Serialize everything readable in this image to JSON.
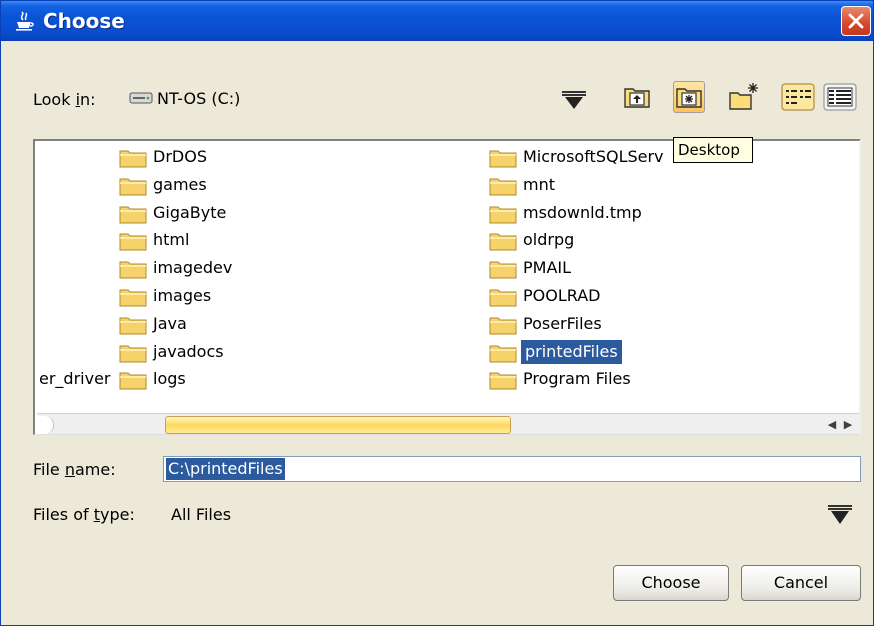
{
  "window": {
    "title": "Choose",
    "icon": "java-cup-icon",
    "close_icon": "close-icon"
  },
  "lookin": {
    "label": "Look in:",
    "mnemonic": "i",
    "value": "NT-OS (C:)",
    "icon": "drive-icon"
  },
  "toolbar": {
    "up_icon": "up-one-level-icon",
    "desktop_icon": "desktop-icon",
    "new_folder_icon": "new-folder-icon",
    "list_icon": "list-view-icon",
    "details_icon": "details-view-icon"
  },
  "tooltip": "Desktop",
  "files": {
    "cut_left_label": "er_driver",
    "col1": [
      "DrDOS",
      "games",
      "GigaByte",
      "html",
      "imagedev",
      "images",
      "Java",
      "javadocs",
      "logs"
    ],
    "col2": [
      "MicrosoftSQLServ",
      "mnt",
      "msdownld.tmp",
      "oldrpg",
      "PMAIL",
      "POOLRAD",
      "PoserFiles",
      "printedFiles",
      "Program Files"
    ],
    "selected": "printedFiles"
  },
  "filename": {
    "label": "File name:",
    "mnemonic": "n",
    "value": "C:\\printedFiles"
  },
  "filetype": {
    "label": "Files of type:",
    "mnemonic": "t",
    "value": "All Files"
  },
  "buttons": {
    "choose": "Choose",
    "cancel": "Cancel"
  },
  "colors": {
    "titlebar": "#0a53d6",
    "selection": "#2b5a9e",
    "folder": "#f5d36a",
    "tooltip_bg": "#ffffe1"
  }
}
